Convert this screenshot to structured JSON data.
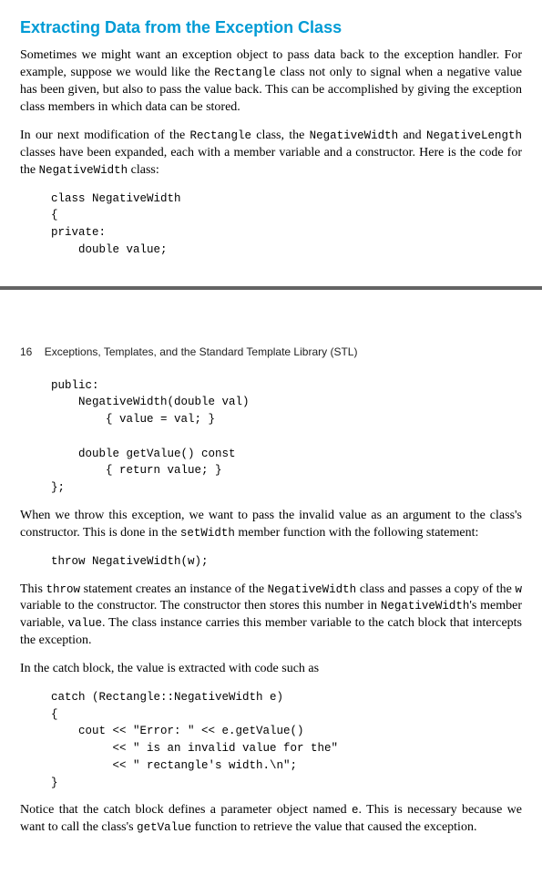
{
  "section": {
    "title": "Extracting Data from the Exception Class"
  },
  "para1": {
    "t1": "Sometimes we might want an exception object to pass data back to the exception handler. For example, suppose we would like the ",
    "c1": "Rectangle",
    "t2": " class not only to signal when a negative value has been given, but also to pass the value back. This can be accomplished by giving the exception class members in which data can be stored."
  },
  "para2": {
    "t1": "In our next modification of the ",
    "c1": "Rectangle",
    "t2": " class, the ",
    "c2": "NegativeWidth",
    "t3": " and ",
    "c3": "NegativeLength",
    "t4": " classes have been expanded, each with a member variable and a constructor. Here is the code for the ",
    "c4": "NegativeWidth",
    "t5": " class:"
  },
  "code1": "class NegativeWidth\n{\nprivate:\n    double value;",
  "running_head": {
    "page_num": "16",
    "text": "Exceptions, Templates, and the Standard Template Library (STL)"
  },
  "code2": "public:\n    NegativeWidth(double val)\n        { value = val; }\n\n    double getValue() const\n        { return value; }\n};",
  "para3": {
    "t1": "When we throw this exception, we want to pass the invalid value as an argument to the class's constructor. This is done in the ",
    "c1": "setWidth",
    "t2": " member function with the following statement:"
  },
  "code3": "throw NegativeWidth(w);",
  "para4": {
    "t1": "This ",
    "c1": "throw",
    "t2": " statement creates an instance of the ",
    "c2": "NegativeWidth",
    "t3": " class and passes a copy of the ",
    "c3": "w",
    "t4": " variable to the constructor. The constructor then stores this number in ",
    "c4": "NegativeWidth",
    "t5": "'s member variable, ",
    "c5": "value",
    "t6": ". The class instance carries this member variable to the catch block that intercepts the exception."
  },
  "para5": {
    "t1": "In the catch block, the value is extracted with code such as"
  },
  "code4": "catch (Rectangle::NegativeWidth e)\n{\n    cout << \"Error: \" << e.getValue()\n         << \" is an invalid value for the\"\n         << \" rectangle's width.\\n\";\n}",
  "para6": {
    "t1": "Notice that the catch block defines a parameter object named ",
    "c1": "e",
    "t2": ". This is necessary because we want to call the class's ",
    "c2": "getValue",
    "t3": " function to retrieve the value that caused the exception."
  }
}
